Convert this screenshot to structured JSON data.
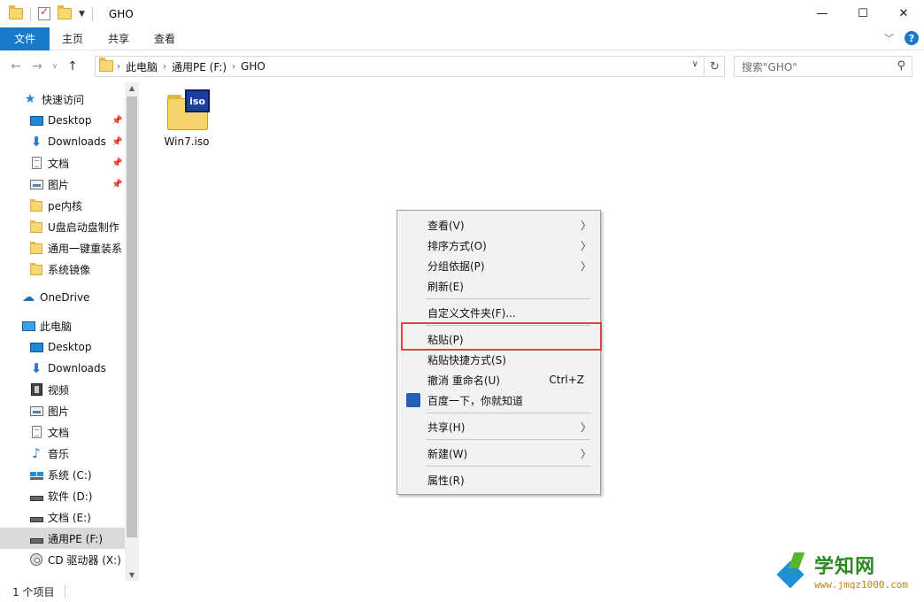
{
  "window": {
    "title": "GHO",
    "minimize": "—",
    "maximize": "☐",
    "close": "✕"
  },
  "ribbon": {
    "tabs": [
      "文件",
      "主页",
      "共享",
      "查看"
    ],
    "help": "?"
  },
  "address": {
    "crumbs": [
      "此电脑",
      "通用PE (F:)",
      "GHO"
    ],
    "search_placeholder": "搜索\"GHO\""
  },
  "navpane": {
    "quick_access": "快速访问",
    "quick_items": [
      {
        "label": "Desktop",
        "icon": "desktop-icon"
      },
      {
        "label": "Downloads",
        "icon": "download-icon"
      },
      {
        "label": "文档",
        "icon": "document-icon"
      },
      {
        "label": "图片",
        "icon": "picture-icon"
      },
      {
        "label": "pe内核",
        "icon": "folder-icon"
      },
      {
        "label": "U盘启动盘制作",
        "icon": "folder-icon"
      },
      {
        "label": "通用一键重装系",
        "icon": "folder-icon"
      },
      {
        "label": "系统镜像",
        "icon": "folder-icon"
      }
    ],
    "onedrive": "OneDrive",
    "this_pc": "此电脑",
    "pc_items": [
      {
        "label": "Desktop",
        "icon": "desktop-icon"
      },
      {
        "label": "Downloads",
        "icon": "download-icon"
      },
      {
        "label": "视频",
        "icon": "video-icon"
      },
      {
        "label": "图片",
        "icon": "picture-icon"
      },
      {
        "label": "文档",
        "icon": "document-icon"
      },
      {
        "label": "音乐",
        "icon": "music-icon"
      },
      {
        "label": "系统 (C:)",
        "icon": "windows-drive-icon"
      },
      {
        "label": "软件 (D:)",
        "icon": "drive-icon"
      },
      {
        "label": "文档 (E:)",
        "icon": "drive-icon"
      },
      {
        "label": "通用PE (F:)",
        "icon": "drive-icon",
        "selected": true
      },
      {
        "label": "CD 驱动器 (X:)",
        "icon": "cd-drive-icon"
      }
    ]
  },
  "files": [
    {
      "name": "Win7.iso",
      "badge": "iso"
    }
  ],
  "context_menu": {
    "view": "查看(V)",
    "sort": "排序方式(O)",
    "group": "分组依据(P)",
    "refresh": "刷新(E)",
    "customize": "自定义文件夹(F)...",
    "paste": "粘贴(P)",
    "paste_shortcut": "粘贴快捷方式(S)",
    "undo_rename": "撤消 重命名(U)",
    "undo_shortcut": "Ctrl+Z",
    "baidu": "百度一下，你就知道",
    "share": "共享(H)",
    "new": "新建(W)",
    "properties": "属性(R)",
    "arrow": "〉"
  },
  "status": {
    "item_count": "1 个项目"
  },
  "watermark": {
    "name": "学知网",
    "url": "www.jmqz1000.com"
  },
  "colors": {
    "accent": "#1979ca",
    "highlight_box": "#e04343"
  }
}
